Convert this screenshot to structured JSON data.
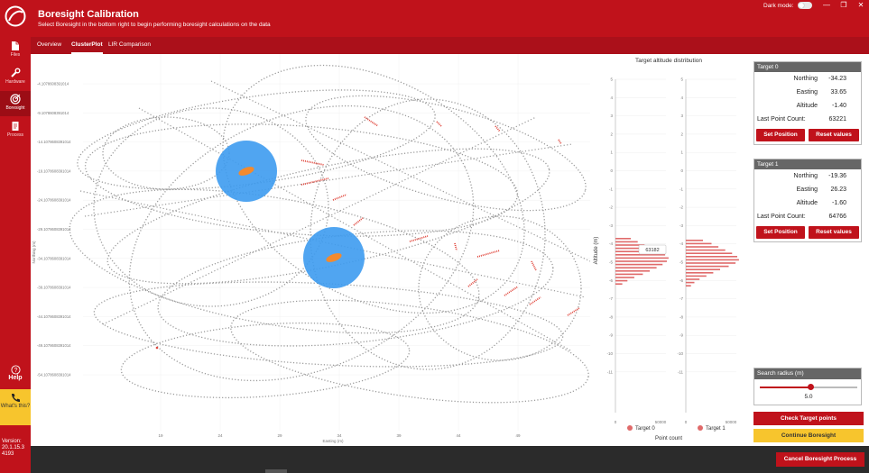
{
  "header": {
    "title": "Boresight Calibration",
    "subtitle": "Select Boresight in the bottom right to begin performing boresight calculations on the data",
    "dark_mode_label": "Dark mode:",
    "window_buttons": [
      "—",
      "❐",
      "✕"
    ]
  },
  "tabs": [
    {
      "label": "Overview",
      "active": false
    },
    {
      "label": "ClusterPlot",
      "active": true
    },
    {
      "label": "LIR Comparison",
      "active": false
    }
  ],
  "sidebar": {
    "items": [
      {
        "label": "Files",
        "icon": "file-icon",
        "active": false
      },
      {
        "label": "Hardware",
        "icon": "wrench-icon",
        "active": false
      },
      {
        "label": "Boresight",
        "icon": "target-icon",
        "active": true
      },
      {
        "label": "Process",
        "icon": "document-icon",
        "active": false
      }
    ],
    "help_label": "Help",
    "whats_this_label": "What's this?",
    "version_label": "Version:",
    "version_number": "20.1.15.3",
    "build_number": "4193"
  },
  "cluster_plot": {
    "ylabel": "Northing (m)",
    "xlabel": "Easting (m)",
    "y_ticks": [
      "-4.1078608391014",
      "-9.1078608391014",
      "-14.1078608391014",
      "-19.1078608391014",
      "-24.1078608391014",
      "-29.1078608391014",
      "-34.1078608391014",
      "-39.1078608391014",
      "-44.1078608391014",
      "-49.1078608391014",
      "-54.1078608391014"
    ],
    "x_ticks": [
      "19",
      "24",
      "29",
      "34",
      "39",
      "44",
      "49"
    ],
    "colors": {
      "trajectory": "#9a9a9a",
      "points": "#e0463c",
      "target": "#3d9bf0",
      "cluster": "#f28a2e"
    }
  },
  "histogram": {
    "title": "Target altitude distribution",
    "ylabel": "Altitude (m)",
    "xlabel": "Point count",
    "y_ticks": [
      "5",
      "4",
      "3",
      "2",
      "1",
      "0",
      "-1",
      "-2",
      "-3",
      "-4",
      "-5",
      "-6",
      "-7",
      "-8",
      "-9",
      "-10",
      "-11"
    ],
    "x_ticks_left": [
      "0",
      "50000"
    ],
    "x_ticks_right": [
      "0",
      "50000"
    ],
    "tooltip_value": "63182",
    "legend": [
      "Target 0",
      "Target 1"
    ],
    "colors": {
      "bars": "#e06a6a"
    }
  },
  "targets": [
    {
      "title": "Target 0",
      "northing_label": "Northing",
      "northing": "-34.23",
      "easting_label": "Easting",
      "easting": "33.65",
      "altitude_label": "Altitude",
      "altitude": "-1.40",
      "count_label": "Last Point Count:",
      "count": "63221",
      "set_position": "Set Position",
      "reset_values": "Reset values"
    },
    {
      "title": "Target 1",
      "northing_label": "Northing",
      "northing": "-19.36",
      "easting_label": "Easting",
      "easting": "26.23",
      "altitude_label": "Altitude",
      "altitude": "-1.60",
      "count_label": "Last Point Count:",
      "count": "64766",
      "set_position": "Set Position",
      "reset_values": "Reset values"
    }
  ],
  "search_radius": {
    "title": "Search radius (m)",
    "value": "5.0",
    "fraction": 0.52
  },
  "actions": {
    "check_target_points": "Check Target points",
    "continue_boresight": "Continue Boresight",
    "cancel_boresight": "Cancel Boresight Process"
  },
  "accent_color": "#c0121b",
  "warning_color": "#f7c52d"
}
